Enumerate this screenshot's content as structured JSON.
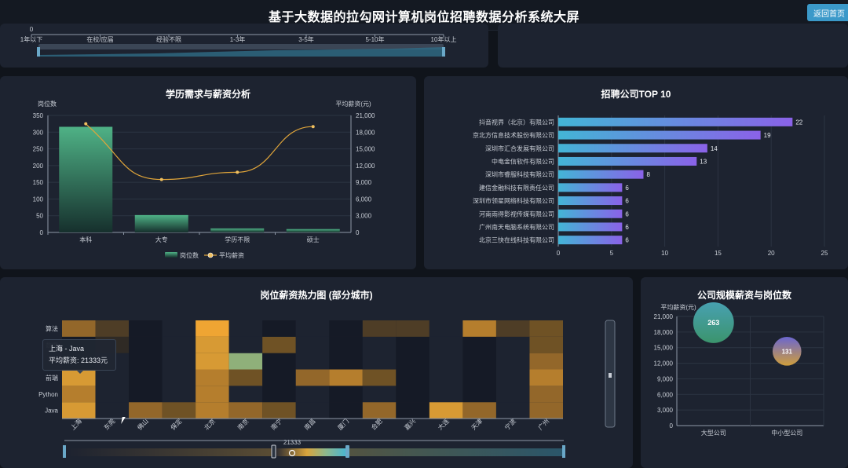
{
  "header": {
    "title": "基于大数据的拉勾网计算机岗位招聘数据分析系统大屏",
    "back_label": "返回首页"
  },
  "experience_panel": {
    "categories": [
      "1年以下",
      "在校/应届",
      "经验不限",
      "1-3年",
      "3-5年",
      "5-10年",
      "10年以上"
    ],
    "zero_label": "0"
  },
  "education_panel": {
    "title": "学历需求与薪资分析",
    "chart_data": {
      "type": "bar",
      "categories": [
        "本科",
        "大专",
        "学历不限",
        "硕士"
      ],
      "series": [
        {
          "name": "岗位数",
          "type": "bar",
          "values": [
            316,
            52,
            12,
            10
          ]
        },
        {
          "name": "平均薪资",
          "type": "line",
          "values": [
            19500,
            9500,
            10800,
            19000
          ]
        }
      ],
      "ylabel_left": "岗位数",
      "ylabel_right": "平均薪资(元)",
      "ylim_left": [
        0,
        350
      ],
      "ylim_right": [
        0,
        21000
      ],
      "left_ticks": [
        "0",
        "50",
        "100",
        "150",
        "200",
        "250",
        "300",
        "350"
      ],
      "right_ticks": [
        "0",
        "3,000",
        "6,000",
        "9,000",
        "12,000",
        "15,000",
        "18,000",
        "21,000"
      ]
    },
    "legend": [
      "岗位数",
      "平均薪资"
    ]
  },
  "company_panel": {
    "title": "招聘公司TOP 10",
    "chart_data": {
      "type": "bar",
      "orientation": "horizontal",
      "categories": [
        "抖音视界（北京）有限公司",
        "京北方信息技术股份有限公司",
        "深圳市汇合发展有限公司",
        "中电金信软件有限公司",
        "深圳市睿服科技有限公司",
        "建信金融科技有限责任公司",
        "深圳市领星网络科技有限公司",
        "河南雨得影视传媒有限公司",
        "广州南天电脑系统有限公司",
        "北京三快在线科技有限公司"
      ],
      "values": [
        22,
        19,
        14,
        13,
        8,
        6,
        6,
        6,
        6,
        6
      ],
      "xlim": [
        0,
        25
      ],
      "x_ticks": [
        "0",
        "5",
        "10",
        "15",
        "20",
        "25"
      ]
    }
  },
  "heatmap_panel": {
    "title": "岗位薪资热力图 (部分城市)",
    "chart_data": {
      "type": "heatmap",
      "x": [
        "上海",
        "东莞",
        "佛山",
        "保定",
        "北京",
        "南京",
        "南宁",
        "南昌",
        "厦门",
        "合肥",
        "嘉兴",
        "大连",
        "天津",
        "宁波",
        "广州"
      ],
      "y": [
        "Java",
        "Python",
        "前端",
        "大数据",
        "数据",
        "算法"
      ],
      "y_visible_labels": [
        "Java",
        "Python",
        "前端",
        "数据",
        "算法"
      ]
    },
    "tooltip": {
      "line1": "上海 - Java",
      "line2": "平均薪资: 21333元"
    },
    "slider_value": "21333"
  },
  "scale_panel": {
    "title": "公司规模薪资与岗位数",
    "chart_data": {
      "type": "scatter",
      "categories": [
        "大型公司",
        "中小型公司"
      ],
      "series": [
        {
          "values": [
            {
              "x": "大型公司",
              "y": 19800,
              "size": 263
            },
            {
              "x": "中小型公司",
              "y": 14300,
              "size": 131
            }
          ]
        }
      ],
      "ylabel": "平均薪资(元)",
      "ylim": [
        0,
        21000
      ],
      "y_ticks": [
        "0",
        "3,000",
        "6,000",
        "9,000",
        "12,000",
        "15,000",
        "18,000",
        "21,000"
      ]
    },
    "bubble_labels": [
      "263",
      "131"
    ]
  }
}
